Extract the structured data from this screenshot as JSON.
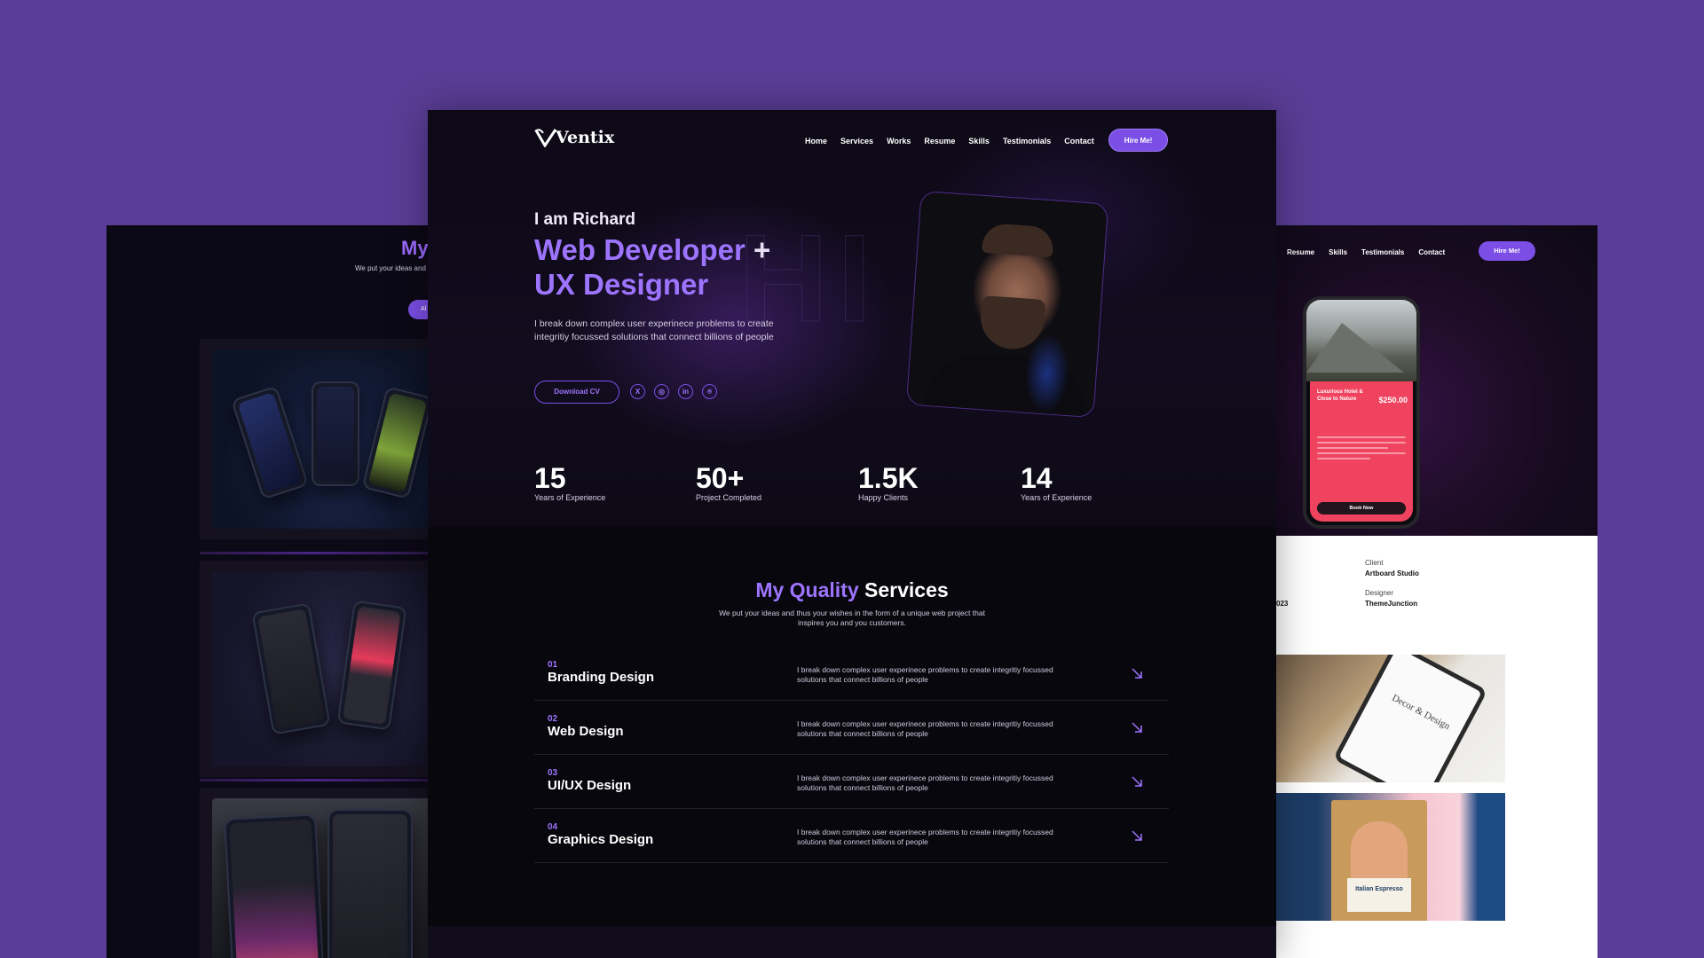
{
  "left_panel": {
    "title": "My",
    "subtitle": "We put your ideas and t",
    "pill": "Al"
  },
  "right_panel": {
    "nav": [
      "Resume",
      "Skills",
      "Testimonials",
      "Contact"
    ],
    "hire_label": "Hire Me!",
    "phone": {
      "hotel_name": "Luxurious Hotel & Close to Nature",
      "price": "$250.00",
      "book_label": "Book Now"
    },
    "meta": {
      "client_label": "Client",
      "client_value": "Artboard Studio",
      "designer_label": "Designer",
      "designer_value": "ThemeJunction",
      "date_fragment": "023"
    },
    "gallery": {
      "tablet_text": "Decor & Design",
      "bag_label": "Italian Espresso"
    }
  },
  "main": {
    "logo": "Ventix",
    "nav": [
      "Home",
      "Services",
      "Works",
      "Resume",
      "Skills",
      "Testimonials",
      "Contact"
    ],
    "hire_label": "Hire Me!",
    "bg_text": "HI",
    "greeting": "I am Richard",
    "headline_1": "Web Developer",
    "headline_plus": " +",
    "headline_2": "UX Designer",
    "intro": "I break down complex user experinece problems to create integritiy focussed solutions that connect billions of people",
    "download_label": "Download CV",
    "socials": [
      {
        "icon": "x-twitter-icon",
        "glyph": "X"
      },
      {
        "icon": "dribbble-icon",
        "glyph": "◎"
      },
      {
        "icon": "linkedin-icon",
        "glyph": "in"
      },
      {
        "icon": "github-icon",
        "glyph": "⌾"
      }
    ],
    "stats": [
      {
        "value": "15",
        "label": "Years of Experience"
      },
      {
        "value": "50+",
        "label": "Project Completed"
      },
      {
        "value": "1.5K",
        "label": "Happy Clients"
      },
      {
        "value": "14",
        "label": "Years of Experience"
      }
    ],
    "services": {
      "title_accent": "My Quality",
      "title_rest": " Services",
      "subtitle": "We put your ideas and thus your wishes in the form of a unique web project that inspires you and you customers.",
      "items": [
        {
          "no": "01",
          "name": "Branding Design",
          "desc": "I break down complex user experinece problems to create integritiy focussed solutions that connect billions of people"
        },
        {
          "no": "02",
          "name": "Web Design",
          "desc": "I break down complex user experinece problems to create integritiy focussed solutions that connect billions of people"
        },
        {
          "no": "03",
          "name": "UI/UX Design",
          "desc": "I break down complex user experinece problems to create integritiy focussed solutions that connect billions of people"
        },
        {
          "no": "04",
          "name": "Graphics Design",
          "desc": "I break down complex user experinece problems to create integritiy focussed solutions that connect billions of people"
        }
      ]
    }
  },
  "colors": {
    "background": "#5a3d96",
    "accent": "#7b4ee6",
    "accent_text": "#9d74ff",
    "panel_dark": "#0a0810"
  }
}
